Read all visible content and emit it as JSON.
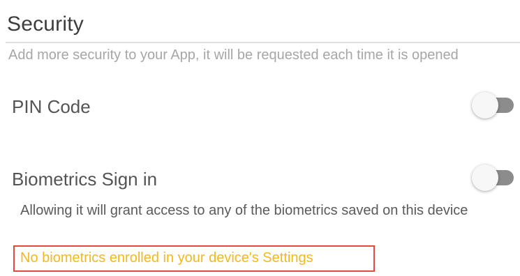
{
  "section": {
    "title": "Security",
    "description": "Add more security to your App, it will be requested each time it is opened"
  },
  "settings": [
    {
      "label": "PIN Code",
      "enabled": false
    },
    {
      "label": "Biometrics Sign in",
      "enabled": false,
      "description": "Allowing it will grant access to any of the biometrics saved on this device",
      "warning": "No biometrics enrolled in your device's Settings"
    }
  ],
  "colors": {
    "warning_text": "#f5b81c",
    "highlight_border": "#e8473e",
    "toggle_track_off": "#8c8c8c"
  }
}
